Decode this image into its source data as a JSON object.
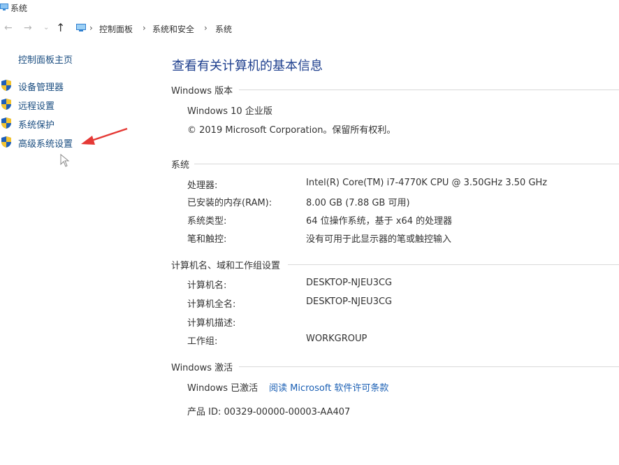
{
  "window": {
    "title": "系统",
    "icon": "system-icon"
  },
  "nav": {
    "back_icon": "arrow-left-icon",
    "forward_icon": "arrow-right-icon",
    "recent_icon": "chevron-down-icon",
    "up_icon": "arrow-up-icon",
    "breadcrumbs": [
      "控制面板",
      "系统和安全",
      "系统"
    ]
  },
  "sidebar": {
    "home": "控制面板主页",
    "items": [
      {
        "label": "设备管理器",
        "icon": "shield-icon"
      },
      {
        "label": "远程设置",
        "icon": "shield-icon"
      },
      {
        "label": "系统保护",
        "icon": "shield-icon"
      },
      {
        "label": "高级系统设置",
        "icon": "shield-icon"
      }
    ]
  },
  "main": {
    "title": "查看有关计算机的基本信息",
    "edition": {
      "header": "Windows 版本",
      "name": "Windows 10 企业版",
      "copyright": "© 2019 Microsoft Corporation。保留所有权利。"
    },
    "system": {
      "header": "系统",
      "rows": [
        {
          "label": "处理器:",
          "value": "Intel(R) Core(TM) i7-4770K CPU @ 3.50GHz   3.50 GHz"
        },
        {
          "label": "已安装的内存(RAM):",
          "value": "8.00 GB (7.88 GB 可用)"
        },
        {
          "label": "系统类型:",
          "value": "64 位操作系统，基于 x64 的处理器"
        },
        {
          "label": "笔和触控:",
          "value": "没有可用于此显示器的笔或触控输入"
        }
      ]
    },
    "computer": {
      "header": "计算机名、域和工作组设置",
      "rows": [
        {
          "label": "计算机名:",
          "value": "DESKTOP-NJEU3CG"
        },
        {
          "label": "计算机全名:",
          "value": "DESKTOP-NJEU3CG"
        },
        {
          "label": "计算机描述:",
          "value": ""
        },
        {
          "label": "工作组:",
          "value": "WORKGROUP"
        }
      ]
    },
    "activation": {
      "header": "Windows 激活",
      "status": "Windows 已激活",
      "license_link": "阅读 Microsoft 软件许可条款",
      "product_id": "产品 ID: 00329-00000-00003-AA407"
    }
  },
  "colors": {
    "link": "#1a5fb4",
    "title": "#1e3f8e",
    "sidebar_link": "#1a4d80",
    "annotation_arrow": "#e53935"
  }
}
